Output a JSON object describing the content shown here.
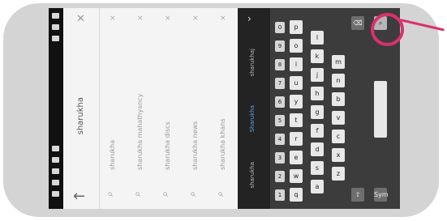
{
  "search": {
    "query": "sharukha",
    "suggestions": [
      {
        "text": "sharukha"
      },
      {
        "text": "sharukha mahathyancy"
      },
      {
        "text": "sharukha discs"
      },
      {
        "text": "sharukha news"
      },
      {
        "text": "sharukha khans"
      }
    ]
  },
  "keyboard_strip": {
    "chips": [
      "sharukha",
      "Sharukha",
      "sharukhaj"
    ]
  },
  "keyboard": {
    "numbers": [
      "1",
      "2",
      "3",
      "4",
      "5",
      "6",
      "7",
      "8",
      "9",
      "0"
    ],
    "row1": [
      "q",
      "w",
      "e",
      "r",
      "t",
      "y",
      "u",
      "i",
      "o",
      "p"
    ],
    "row2": [
      "a",
      "s",
      "d",
      "f",
      "g",
      "h",
      "j",
      "k",
      "l"
    ],
    "row3": [
      "z",
      "x",
      "c",
      "v",
      "b",
      "n",
      "m"
    ],
    "sym_label": "Sym"
  },
  "highlight": {
    "color": "#d8316e",
    "target": "keyboard-search-key"
  }
}
